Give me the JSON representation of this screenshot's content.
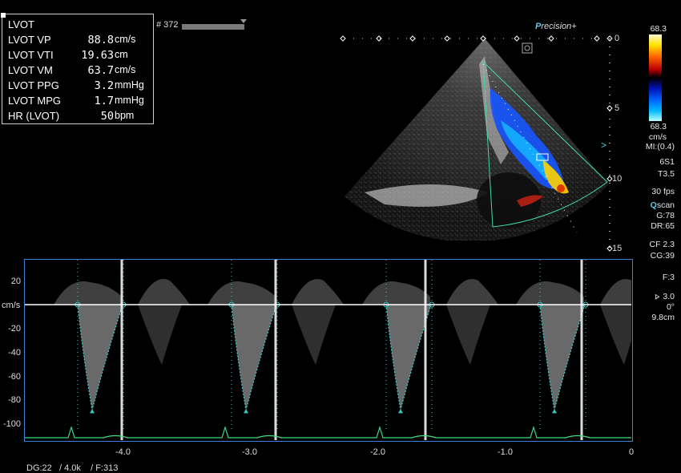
{
  "measurements": {
    "title": "LVOT",
    "rows": [
      {
        "label": "LVOT VP",
        "value": "88.8",
        "unit": "cm/s"
      },
      {
        "label": "LVOT VTI",
        "value": "19.63",
        "unit": "cm"
      },
      {
        "label": "LVOT VM",
        "value": "63.7",
        "unit": "cm/s"
      },
      {
        "label": "LVOT PPG",
        "value": "3.2",
        "unit": "mmHg"
      },
      {
        "label": "LVOT MPG",
        "value": "1.7",
        "unit": "mmHg"
      },
      {
        "label": "HR (LVOT)",
        "value": "50",
        "unit": "bpm"
      }
    ]
  },
  "frame_counter": "# 372",
  "brand": {
    "prefix": "P",
    "rest": "recision",
    "suffix": "+"
  },
  "color_scale": {
    "top_value": "68.3",
    "bottom_value": "68.3",
    "unit": "cm/s",
    "mi": "MI:(0.4)"
  },
  "settings": {
    "probe": "6S1",
    "preset": "T3.5",
    "fps": "30 fps",
    "qscan_q": "Q",
    "qscan_rest": "scan",
    "gain": "G:78",
    "dynamic_range": "DR:65",
    "cf": "CF 2.3",
    "cg": "CG:39",
    "filter": "F:3",
    "angle_value": "3.0",
    "angle_deg": "0°",
    "depth": "9.8cm"
  },
  "depth_scale": {
    "labels": [
      "0",
      "5",
      "10",
      "15"
    ]
  },
  "spectral": {
    "unit_label": "cm/s",
    "y_ticks": [
      "20",
      "-20",
      "-40",
      "-60",
      "-80",
      "-100"
    ],
    "x_ticks": [
      "-4.0",
      "-3.0",
      "-2.0",
      "-1.0",
      "0"
    ],
    "waveform": {
      "peak_velocity_cm_s": -88.8,
      "heart_rate_bpm": 50,
      "beats_visible": 4
    }
  },
  "footer": "DG:22   / 4.0k    / F:313",
  "colors": {
    "trace": "#3cc9c9",
    "frame_border": "#3f7fd6",
    "ecg": "#3fd98a",
    "brand_accent": "#5cc9e6"
  }
}
